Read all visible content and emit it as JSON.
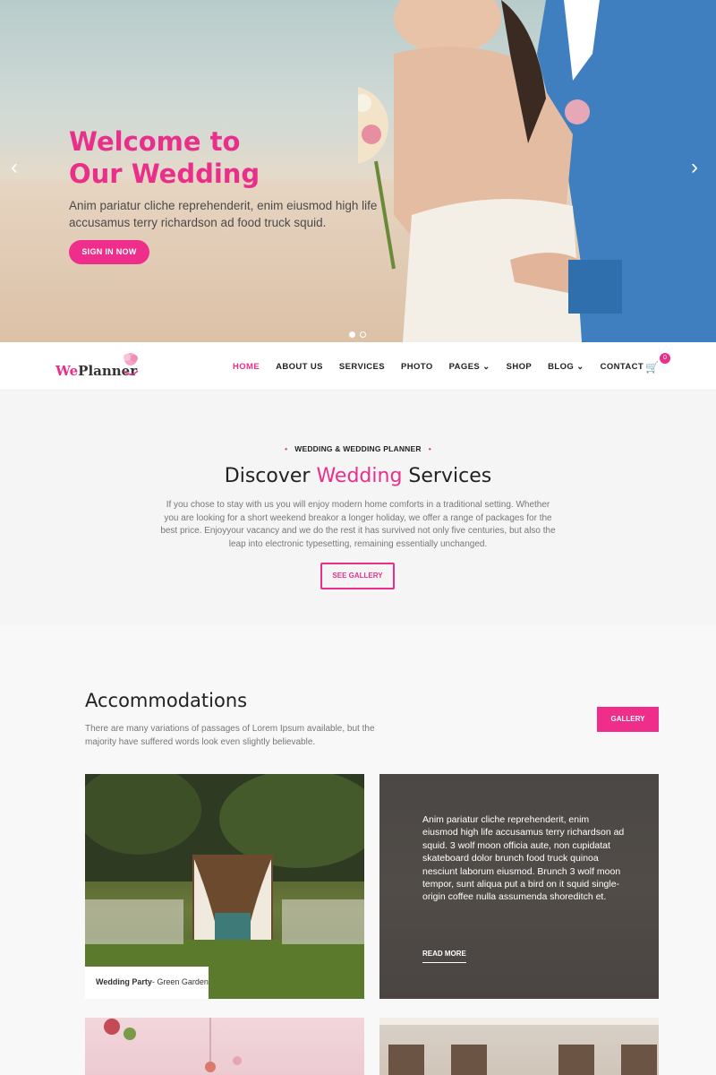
{
  "hero": {
    "title_line1": "Welcome to",
    "title_line2": "Our Wedding",
    "text": "Anim pariatur cliche reprehenderit, enim eiusmod high life accusamus terry richardson ad food truck squid.",
    "button": "SIGN IN NOW",
    "prev_icon": "chevron-left-icon",
    "next_icon": "chevron-right-icon",
    "slides_count": 2,
    "active_slide": 1
  },
  "nav": {
    "logo_we": "We",
    "logo_planner": "Planner",
    "items": [
      {
        "label": "HOME",
        "active": true
      },
      {
        "label": "ABOUT US"
      },
      {
        "label": "SERVICES"
      },
      {
        "label": "PHOTO"
      },
      {
        "label": "PAGES",
        "dropdown": true
      },
      {
        "label": "SHOP"
      },
      {
        "label": "BLOG",
        "dropdown": true
      },
      {
        "label": "CONTACT"
      }
    ],
    "cart_count": "0"
  },
  "services": {
    "eyebrow": "WEDDING & WEDDING PLANNER",
    "title_before": "Discover ",
    "title_pink": "Wedding",
    "title_after": " Services",
    "text": "If you chose to stay with us you will enjoy modern home comforts in a traditional setting. Whether you are looking for a short weekend breakor a longer holiday, we offer a range of packages for the best price. Enjoyyour vacancy and we do the rest it has survived not only five centuries, but also the leap into electronic typesetting, remaining essentially unchanged.",
    "button": "SEE GALLERY"
  },
  "accommodations": {
    "title": "Accommodations",
    "text": "There are many variations of passages of Lorem Ipsum available, but the majority have suffered words look even slightly believable.",
    "button": "GALLERY",
    "card1_caption_bold": "Wedding Party",
    "card1_caption_rest": "- Green Garden",
    "card2_text": "Anim pariatur cliche reprehenderit, enim eiusmod high life accusamus terry richardson ad squid. 3 wolf moon officia aute, non cupidatat skateboard dolor brunch food truck quinoa nesciunt laborum eiusmod. Brunch 3 wolf moon tempor, sunt aliqua put a bird on it squid single-origin coffee nulla assumenda shoreditch et.",
    "card2_link": "READ MORE"
  },
  "colors": {
    "accent": "#e8308b"
  }
}
